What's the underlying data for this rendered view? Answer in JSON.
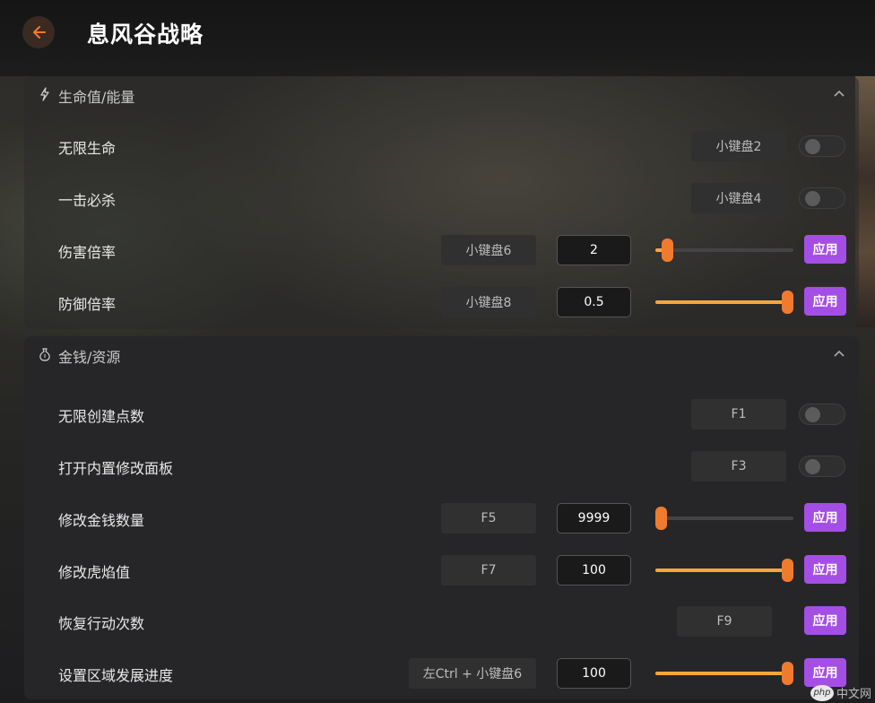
{
  "header": {
    "title": "息风谷战略"
  },
  "sections": [
    {
      "title": "生命值/能量",
      "icon": "lightning-icon",
      "rows": [
        {
          "label": "无限生命",
          "hotkey": "小键盘2",
          "type": "toggle",
          "on": false
        },
        {
          "label": "一击必杀",
          "hotkey": "小键盘4",
          "type": "toggle",
          "on": false
        },
        {
          "label": "伤害倍率",
          "hotkey": "小键盘6",
          "type": "slider",
          "value": "2",
          "level": 0.05,
          "apply": "应用"
        },
        {
          "label": "防御倍率",
          "hotkey": "小键盘8",
          "type": "slider",
          "value": "0.5",
          "level": 1.0,
          "apply": "应用"
        }
      ]
    },
    {
      "title": "金钱/资源",
      "icon": "money-bag-icon",
      "rows": [
        {
          "label": "无限创建点数",
          "hotkey": "F1",
          "type": "toggle",
          "on": false
        },
        {
          "label": "打开内置修改面板",
          "hotkey": "F3",
          "type": "toggle",
          "on": false
        },
        {
          "label": "修改金钱数量",
          "hotkey": "F5",
          "type": "slider",
          "value": "9999",
          "level": 0.0,
          "apply": "应用"
        },
        {
          "label": "修改虎焰值",
          "hotkey": "F7",
          "type": "slider",
          "value": "100",
          "level": 1.0,
          "apply": "应用"
        },
        {
          "label": "恢复行动次数",
          "hotkey": "F9",
          "type": "button",
          "apply": "应用"
        },
        {
          "label": "设置区域发展进度",
          "hotkey": "左Ctrl + 小键盘6",
          "type": "slider",
          "value": "100",
          "level": 1.0,
          "apply": "应用"
        }
      ]
    }
  ],
  "watermark": {
    "logo": "php",
    "text": "中文网"
  },
  "colors": {
    "accent": "#f07a2e",
    "fill": "#f5a73c",
    "apply": "#a44ee6"
  }
}
